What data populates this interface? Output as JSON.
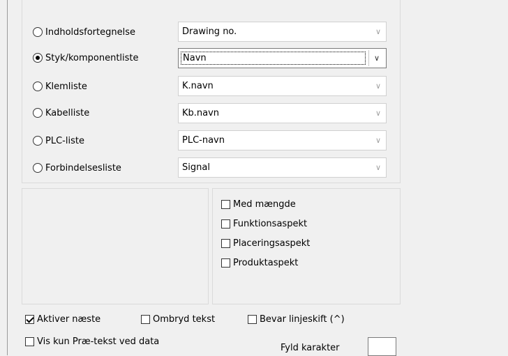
{
  "list_types": [
    {
      "label": "Indholdsfortegnelse",
      "checked": false,
      "field": "Drawing no."
    },
    {
      "label": "Styk/komponentliste",
      "checked": true,
      "field": "Navn"
    },
    {
      "label": "Klemliste",
      "checked": false,
      "field": "K.navn"
    },
    {
      "label": "Kabelliste",
      "checked": false,
      "field": "Kb.navn"
    },
    {
      "label": "PLC-liste",
      "checked": false,
      "field": "PLC-navn"
    },
    {
      "label": "Forbindelsesliste",
      "checked": false,
      "field": "Signal"
    }
  ],
  "aspects": [
    {
      "label": "Med mængde",
      "checked": false
    },
    {
      "label": "Funktionsaspekt",
      "checked": false
    },
    {
      "label": "Placeringsaspekt",
      "checked": false
    },
    {
      "label": "Produktaspekt",
      "checked": false
    }
  ],
  "options": {
    "aktiver_naeste": {
      "label": "Aktiver næste",
      "checked": true
    },
    "ombryd_tekst": {
      "label": "Ombryd tekst",
      "checked": false
    },
    "bevar_linjeskift": {
      "label": "Bevar linjeskift (^)",
      "checked": false
    },
    "vis_kun_prae": {
      "label": "Vis kun Præ-tekst ved data",
      "checked": false
    }
  },
  "fyld_karakter": {
    "label": "Fyld karakter",
    "value": ""
  }
}
